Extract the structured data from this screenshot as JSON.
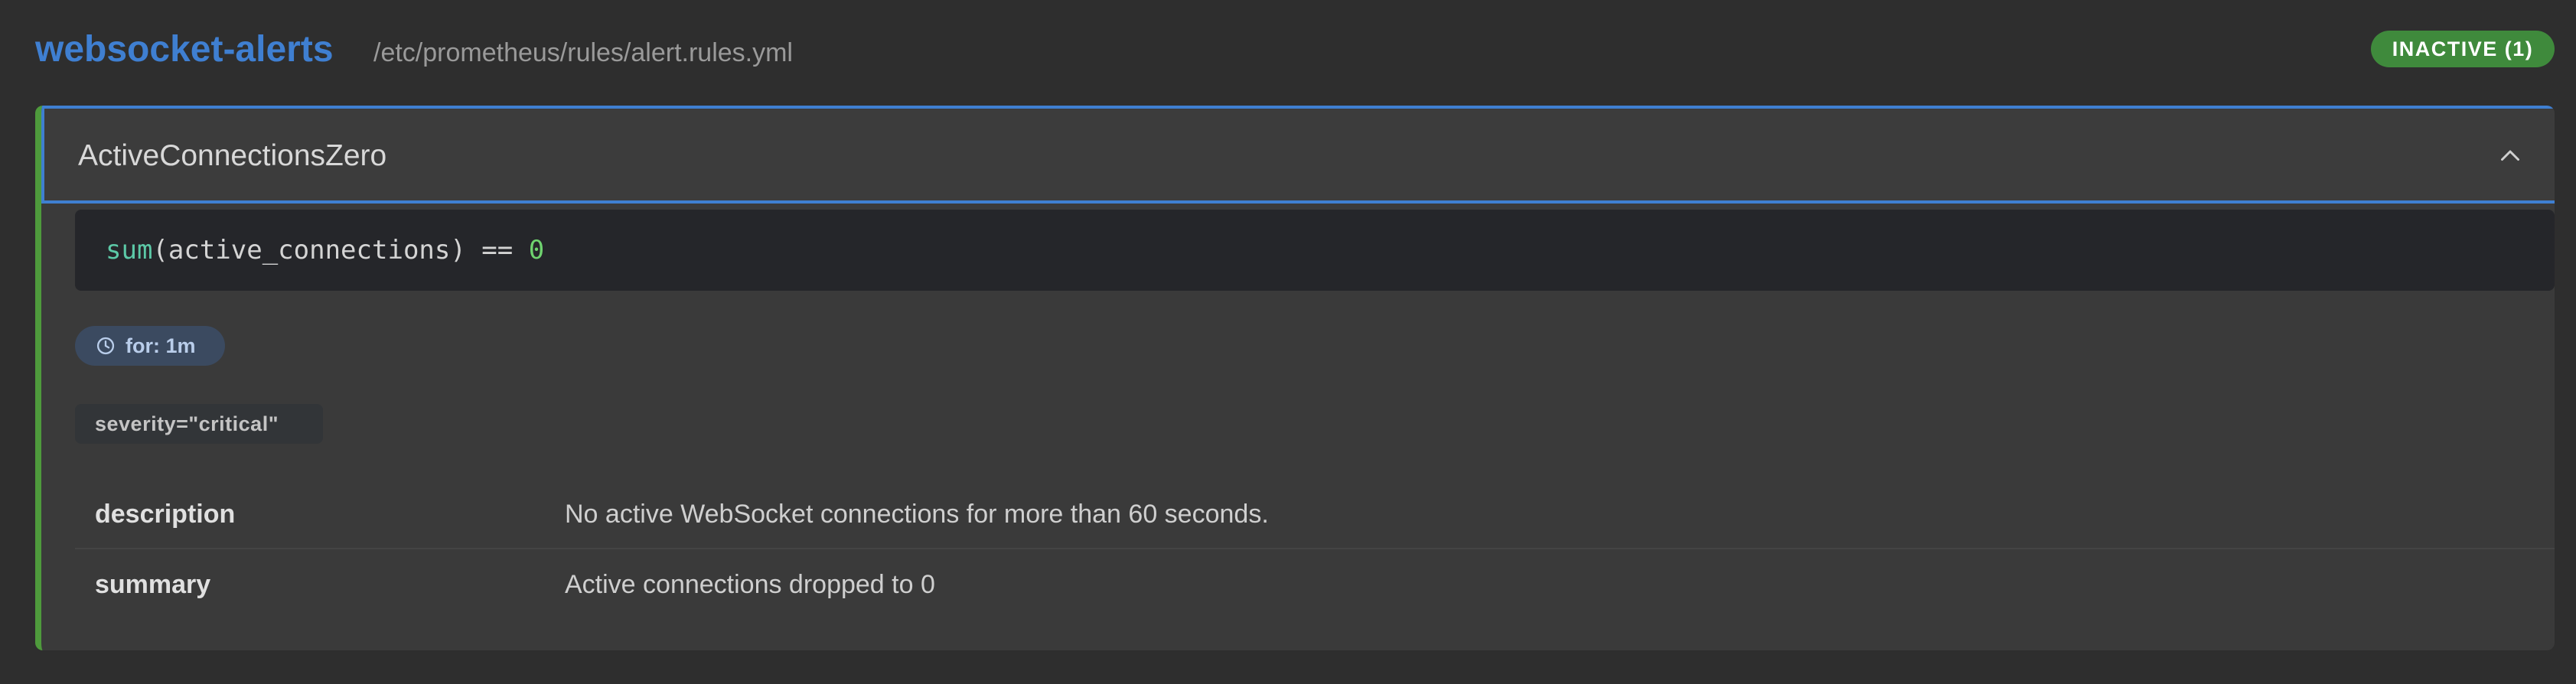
{
  "group": {
    "name": "websocket-alerts",
    "file": "/etc/prometheus/rules/alert.rules.yml",
    "status_badge": "INACTIVE (1)",
    "status_color": "#3f8a3c",
    "accent_color": "#3f7fd1"
  },
  "rule": {
    "name": "ActiveConnectionsZero",
    "expanded": true,
    "toggle_icon": "chevron-up-icon",
    "expression": {
      "function": "sum",
      "body": "(active_connections) == ",
      "value": "0"
    },
    "duration_icon": "clock-icon",
    "duration": "for: 1m",
    "labels": [
      "severity=\"critical\""
    ],
    "annotations": [
      {
        "key": "description",
        "value": "No active WebSocket connections for more than 60 seconds."
      },
      {
        "key": "summary",
        "value": "Active connections dropped to 0"
      }
    ],
    "state_color": "#4e9a3c"
  }
}
